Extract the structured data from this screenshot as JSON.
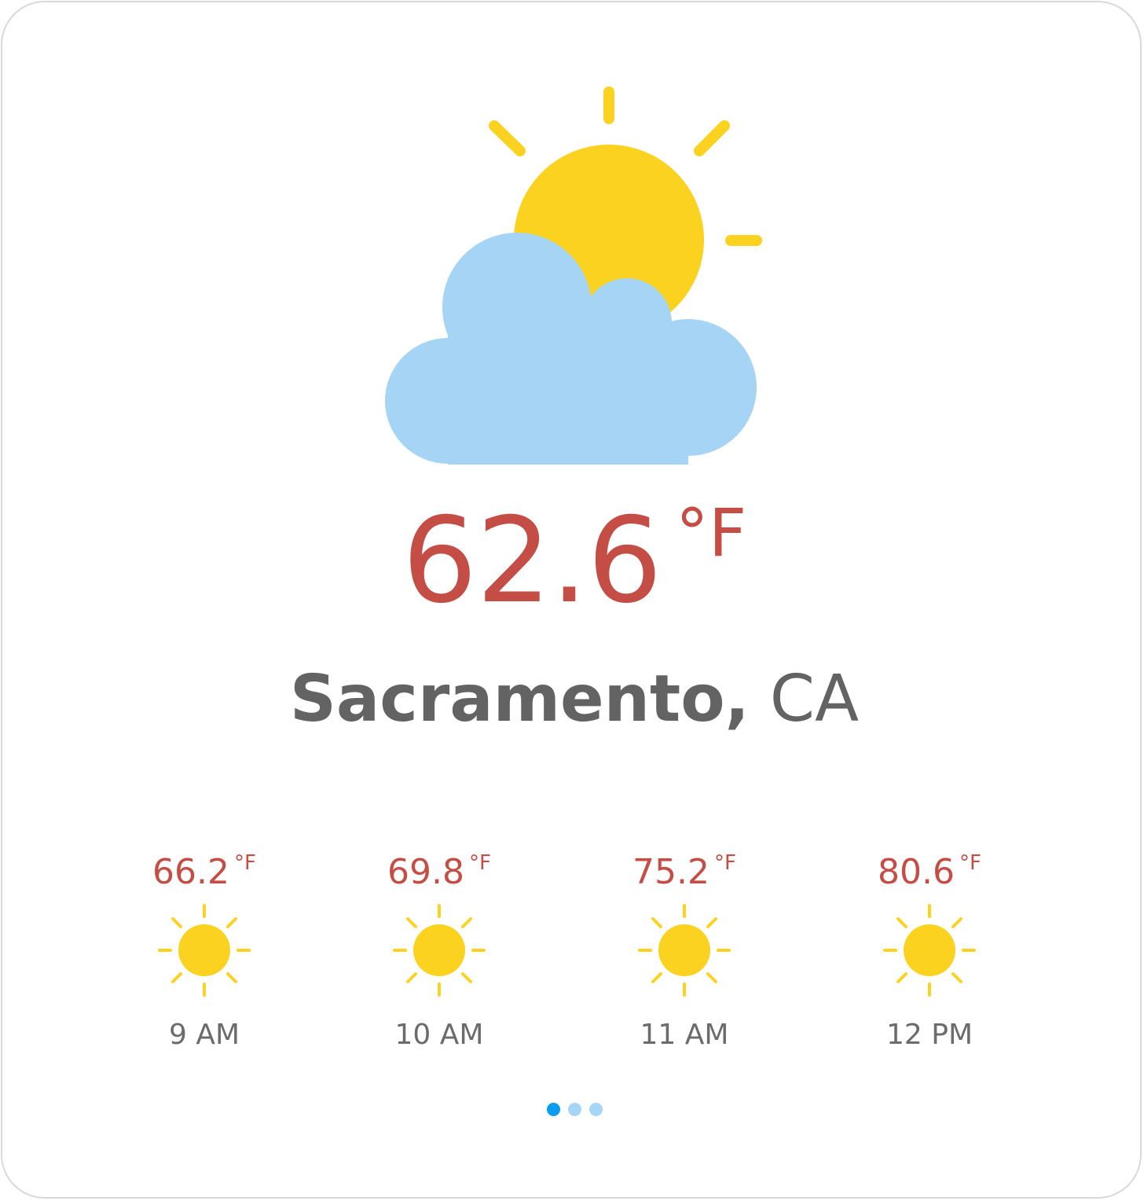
{
  "current": {
    "temperature": "62.6",
    "unit": "°F",
    "condition_icon": "partly-cloudy-icon"
  },
  "location": {
    "city": "Sacramento,",
    "state": "CA"
  },
  "hourly": [
    {
      "temperature": "66.2",
      "unit": "°F",
      "icon": "sun-icon",
      "time": "9 AM"
    },
    {
      "temperature": "69.8",
      "unit": "°F",
      "icon": "sun-icon",
      "time": "10 AM"
    },
    {
      "temperature": "75.2",
      "unit": "°F",
      "icon": "sun-icon",
      "time": "11 AM"
    },
    {
      "temperature": "80.6",
      "unit": "°F",
      "icon": "sun-icon",
      "time": "12 PM"
    }
  ],
  "pagination": {
    "pages": 3,
    "active_page": 1
  },
  "colors": {
    "temperature": "#c44d45",
    "text": "#636363",
    "sun": "#fcd221",
    "cloud": "#a5d4f5",
    "dot_active": "#0a9cf0",
    "dot_inactive": "#a6d6f6"
  }
}
